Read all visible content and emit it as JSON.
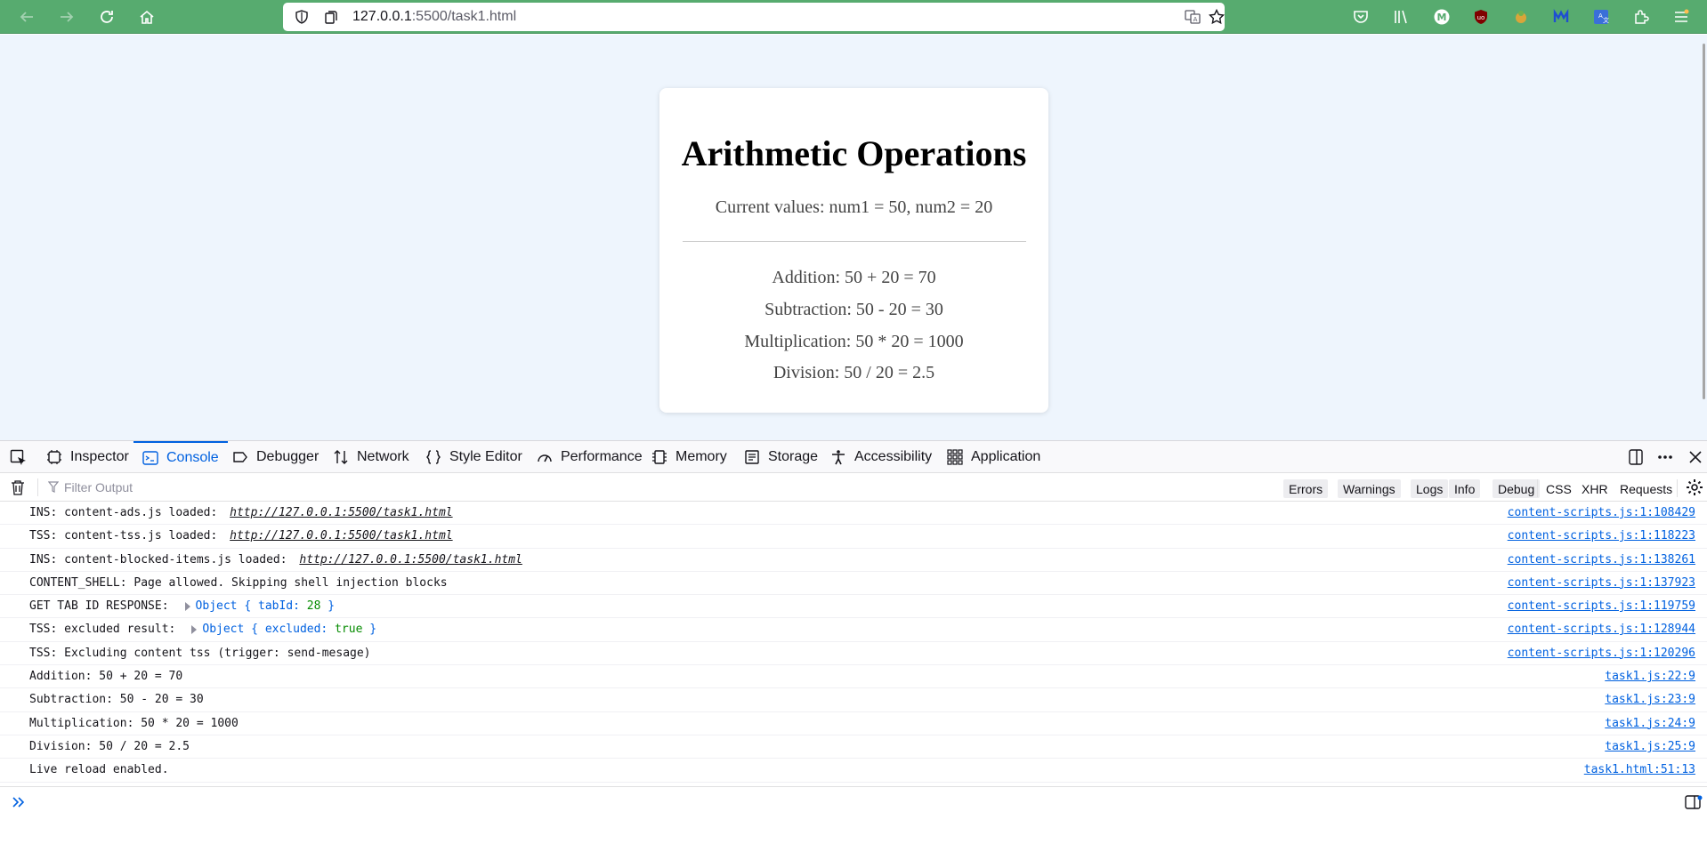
{
  "browser": {
    "url_host": "127.0.0.1",
    "url_rest": ":5500/task1.html",
    "colors": {
      "toolbar": "#57ab6f",
      "link": "#0061e0"
    }
  },
  "page": {
    "title": "Arithmetic Operations",
    "current_values": "Current values: num1 = 50, num2 = 20",
    "results": [
      "Addition: 50 + 20 = 70",
      "Subtraction: 50 - 20 = 30",
      "Multiplication: 50 * 20 = 1000",
      "Division: 50 / 20 = 2.5"
    ]
  },
  "devtools": {
    "tabs": [
      "Inspector",
      "Console",
      "Debugger",
      "Network",
      "Style Editor",
      "Performance",
      "Memory",
      "Storage",
      "Accessibility",
      "Application"
    ],
    "active_tab": "Console",
    "filter_placeholder": "Filter Output",
    "levels": [
      "Errors",
      "Warnings",
      "Logs",
      "Info",
      "Debug"
    ],
    "extra_filters": [
      "CSS",
      "XHR",
      "Requests"
    ],
    "logs": [
      {
        "text": "INS: content-ads.js loaded:",
        "link": "http://127.0.0.1:5500/task1.html",
        "source": "content-scripts.js:1:108429"
      },
      {
        "text": "TSS: content-tss.js loaded:",
        "link": "http://127.0.0.1:5500/task1.html",
        "source": "content-scripts.js:1:118223"
      },
      {
        "text": "INS: content-blocked-items.js loaded:",
        "link": "http://127.0.0.1:5500/task1.html",
        "source": "content-scripts.js:1:138261"
      },
      {
        "text": "CONTENT_SHELL: Page allowed. Skipping shell injection blocks",
        "source": "content-scripts.js:1:137923"
      },
      {
        "text": "GET TAB ID RESPONSE:",
        "object_prefix": "Object { tabId: ",
        "object_value": "28",
        "object_suffix": " }",
        "source": "content-scripts.js:1:119759"
      },
      {
        "text": "TSS: excluded result:",
        "object_prefix": "Object { excluded: ",
        "object_value": "true",
        "object_suffix": " }",
        "source": "content-scripts.js:1:128944"
      },
      {
        "text": "TSS: Excluding content tss (trigger: send-mesage)",
        "source": "content-scripts.js:1:120296"
      },
      {
        "text": "Addition: 50 + 20 = 70",
        "source": "task1.js:22:9"
      },
      {
        "text": "Subtraction: 50 - 20 = 30",
        "source": "task1.js:23:9"
      },
      {
        "text": "Multiplication: 50 * 20 = 1000",
        "source": "task1.js:24:9"
      },
      {
        "text": "Division: 50 / 20 = 2.5",
        "source": "task1.js:25:9"
      },
      {
        "text": "Live reload enabled.",
        "source": "task1.html:51:13"
      }
    ]
  }
}
